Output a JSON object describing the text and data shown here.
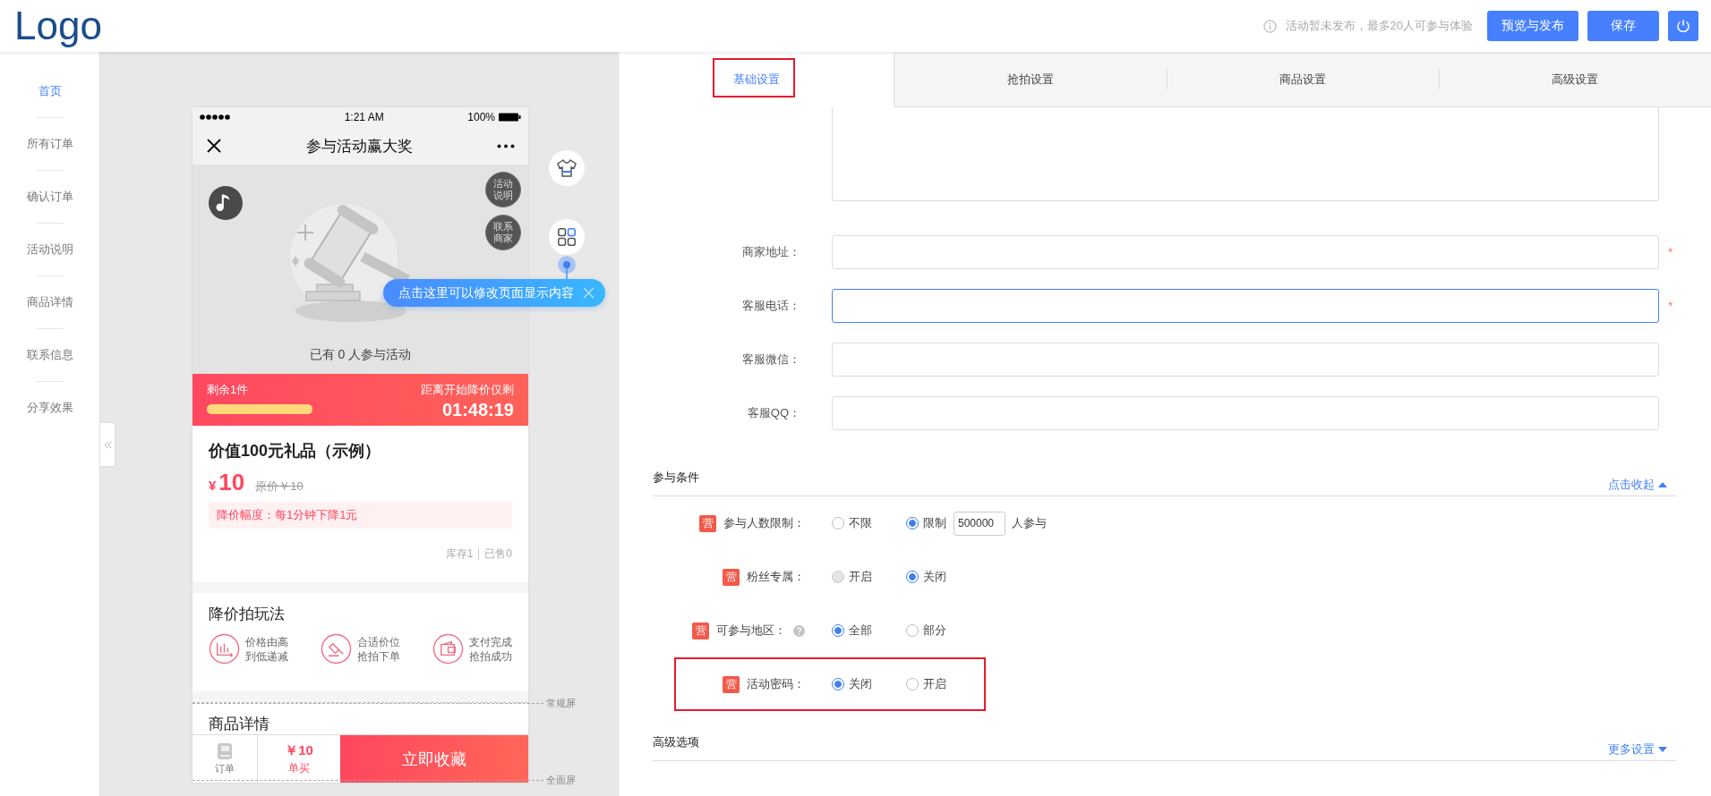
{
  "header": {
    "logo": "Logo",
    "notice": "活动暂未发布，最多20人可参与体验",
    "buttons": [
      {
        "label": "预览与发布"
      },
      {
        "label": "保存"
      }
    ]
  },
  "sidebar": {
    "items": [
      {
        "label": "首页",
        "selected": true
      },
      {
        "label": "所有订单",
        "selected": false
      },
      {
        "label": "确认订单",
        "selected": false
      },
      {
        "label": "活动说明",
        "selected": false
      },
      {
        "label": "商品详情",
        "selected": false
      },
      {
        "label": "联系信息",
        "selected": false
      },
      {
        "label": "分享效果",
        "selected": false
      }
    ]
  },
  "phone": {
    "status": {
      "time": "1:21 AM",
      "battery": "100%"
    },
    "nav_title": "参与活动赢大奖",
    "hero": {
      "side_buttons": [
        "活动说明",
        "联系商家"
      ],
      "participants": "已有 0 人参与活动"
    },
    "band": {
      "remaining": "剩余1件",
      "level": 1,
      "countdown_label": "距离开始降价仅剩",
      "countdown": "01:48:19"
    },
    "product": {
      "title": "价值100元礼品（示例）",
      "currency": "¥",
      "price": "10",
      "original_price": "原价￥10",
      "drop_rule": "降价幅度：每1分钟下降1元",
      "stock": "库存1",
      "sold": "已售0"
    },
    "gameplay": {
      "title": "降价拍玩法",
      "steps": [
        {
          "kind": "chart",
          "lines": [
            "价格由高",
            "到低递减"
          ]
        },
        {
          "kind": "gavel",
          "lines": [
            "合适价位",
            "抢拍下单"
          ]
        },
        {
          "kind": "wallet",
          "lines": [
            "支付完成",
            "抢拍成功"
          ]
        }
      ]
    },
    "details_title": "商品详情",
    "bottom_bar": {
      "order": "订单",
      "price": "￥10",
      "buy": "单买",
      "cta": "立即收藏"
    }
  },
  "tooltip": "点击这里可以修改页面显示内容",
  "screen_marks": [
    "常规屏",
    "全面屏"
  ],
  "tabs": [
    {
      "label": "基础设置",
      "selected": true,
      "highlighted": true
    },
    {
      "label": "抢拍设置",
      "selected": false,
      "highlighted": false
    },
    {
      "label": "商品设置",
      "selected": false,
      "highlighted": false
    },
    {
      "label": "高级设置",
      "selected": false,
      "highlighted": false
    }
  ],
  "required_mark": "*",
  "fields": [
    {
      "label": "商家地址：",
      "required": true,
      "focused": false
    },
    {
      "label": "客服电话：",
      "required": true,
      "focused": true
    },
    {
      "label": "客服微信：",
      "required": false,
      "focused": false
    },
    {
      "label": "客服QQ：",
      "required": false,
      "focused": false
    }
  ],
  "conditions": {
    "title": "参与条件",
    "toggle": "点击收起",
    "expanded": true,
    "rows": [
      {
        "badge": "营",
        "label": "参与人数限制：",
        "help": false,
        "highlighted": false,
        "options": [
          {
            "label": "不限",
            "selected": false,
            "disabled": false
          },
          {
            "label": "限制",
            "selected": true,
            "disabled": false
          }
        ],
        "value": "500000",
        "suffix": "人参与"
      },
      {
        "badge": "营",
        "label": "粉丝专属：",
        "help": false,
        "highlighted": false,
        "options": [
          {
            "label": "开启",
            "selected": false,
            "disabled": true
          },
          {
            "label": "关闭",
            "selected": true,
            "disabled": false
          }
        ]
      },
      {
        "badge": "营",
        "label": "可参与地区：",
        "help": true,
        "highlighted": false,
        "options": [
          {
            "label": "全部",
            "selected": true,
            "disabled": false
          },
          {
            "label": "部分",
            "selected": false,
            "disabled": false
          }
        ]
      },
      {
        "badge": "营",
        "label": "活动密码：",
        "help": false,
        "highlighted": true,
        "options": [
          {
            "label": "关闭",
            "selected": true,
            "disabled": false
          },
          {
            "label": "开启",
            "selected": false,
            "disabled": false
          }
        ]
      }
    ]
  },
  "advanced": {
    "title": "高级选项",
    "toggle": "更多设置",
    "expanded": false
  }
}
